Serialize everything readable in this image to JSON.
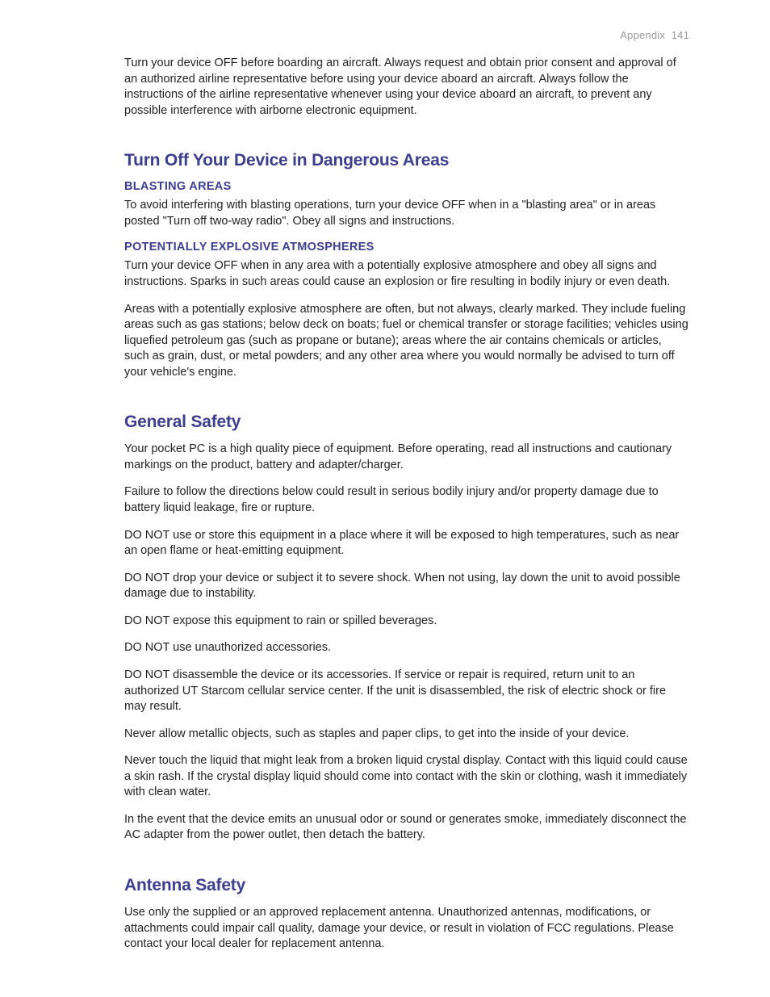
{
  "header": {
    "section": "Appendix",
    "page": "141"
  },
  "intro_para": "Turn your device OFF before boarding an aircraft. Always request and obtain prior consent and approval of an authorized airline representative before using your device aboard an aircraft. Always follow the instructions of the airline representative whenever using your device aboard an aircraft, to prevent any possible interference with airborne electronic equipment.",
  "s1": {
    "title": "Turn Off Your Device in Dangerous Areas",
    "sub1": {
      "title": "BLASTING AREAS",
      "p1": "To avoid interfering with blasting operations, turn your device OFF when in a \"blasting area\" or in areas posted \"Turn off two-way radio\". Obey all signs and instructions."
    },
    "sub2": {
      "title": "POTENTIALLY EXPLOSIVE ATMOSPHERES",
      "p1": "Turn your device OFF when in any area with a potentially explosive atmosphere and obey all signs and instructions. Sparks in such areas could cause an explosion or fire resulting in bodily injury or even death.",
      "p2": "Areas with a potentially explosive atmosphere are often, but not always, clearly marked. They include fueling areas such as gas stations; below deck on boats; fuel or chemical transfer or storage facilities; vehicles using liquefied petroleum gas (such as propane or butane); areas where the air contains chemicals or articles, such as grain, dust, or metal powders; and any other area where you would normally be advised to turn off your vehicle's engine."
    }
  },
  "s2": {
    "title": "General Safety",
    "p1": "Your pocket PC is a high quality piece of equipment.  Before operating, read all instructions and cautionary markings on the product, battery and adapter/charger.",
    "p2": "Failure to follow the directions below could result in serious bodily injury and/or property damage due to battery liquid leakage, fire or rupture.",
    "p3": "DO NOT use or store this equipment in a place where it will be exposed to high temperatures, such as near an open flame or heat-emitting equipment.",
    "p4": "DO NOT drop your device or subject it to severe shock.  When not using, lay down the unit to avoid possible damage due to instability.",
    "p5": "DO NOT expose this equipment to rain or spilled beverages.",
    "p6": "DO NOT use unauthorized accessories.",
    "p7": "DO NOT disassemble the device or its accessories. If service or repair is required, return unit to an authorized UT Starcom cellular service center. If the unit is disassembled, the risk of electric shock or fire may result.",
    "p8": "Never allow metallic objects, such as staples and paper clips, to get into the inside of your device.",
    "p9": "Never touch the liquid that might leak from a broken liquid crystal display. Contact with this liquid could cause a skin rash. If the crystal display liquid should come into contact with the skin or clothing, wash it immediately with clean water.",
    "p10": "In the event that the device emits an unusual odor or sound or generates smoke, immediately disconnect the AC adapter from the power outlet, then detach the battery."
  },
  "s3": {
    "title": "Antenna Safety",
    "p1": "Use only the supplied or an approved replacement antenna. Unauthorized antennas, modifications, or attachments could impair call quality, damage your device, or result in violation of FCC regulations. Please contact your local dealer for replacement antenna."
  }
}
